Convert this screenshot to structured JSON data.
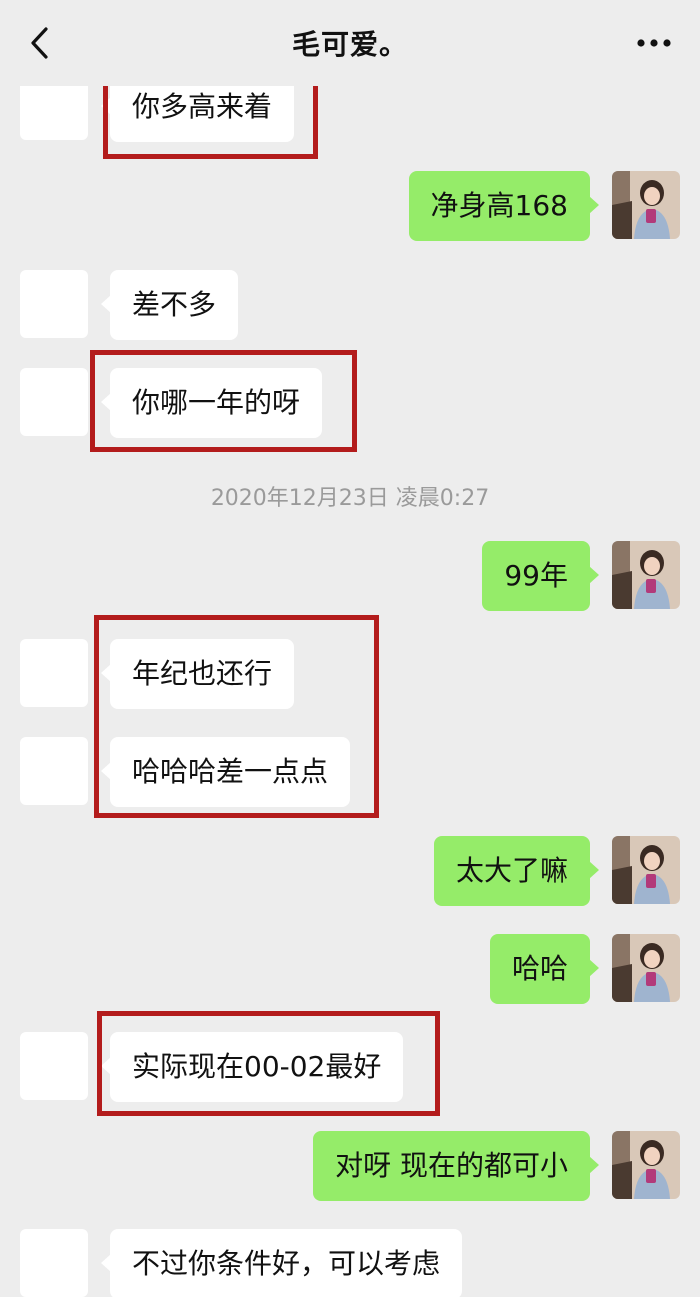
{
  "header": {
    "title": "毛可爱。",
    "back_icon": "chevron-left-icon",
    "more_icon": "more-dots-icon"
  },
  "timestamp": "2020年12月23日 凌晨0:27",
  "messages": [
    {
      "side": "left",
      "text": "你多高来着"
    },
    {
      "side": "right",
      "text": "净身高168"
    },
    {
      "side": "left",
      "text": "差不多"
    },
    {
      "side": "left",
      "text": "你哪一年的呀"
    },
    {
      "side": "right",
      "text": "99年"
    },
    {
      "side": "left",
      "text": "年纪也还行"
    },
    {
      "side": "left",
      "text": "哈哈哈差一点点"
    },
    {
      "side": "right",
      "text": "太大了嘛"
    },
    {
      "side": "right",
      "text": "哈哈"
    },
    {
      "side": "left",
      "text": "实际现在00-02最好"
    },
    {
      "side": "right",
      "text": "对呀 现在的都可小"
    },
    {
      "side": "left",
      "text": "不过你条件好，可以考虑"
    }
  ],
  "colors": {
    "background": "#ededed",
    "bubble_self": "#95ec69",
    "bubble_other": "#ffffff",
    "highlight_box": "#b31c1c",
    "timestamp_text": "#9a9a9a"
  }
}
